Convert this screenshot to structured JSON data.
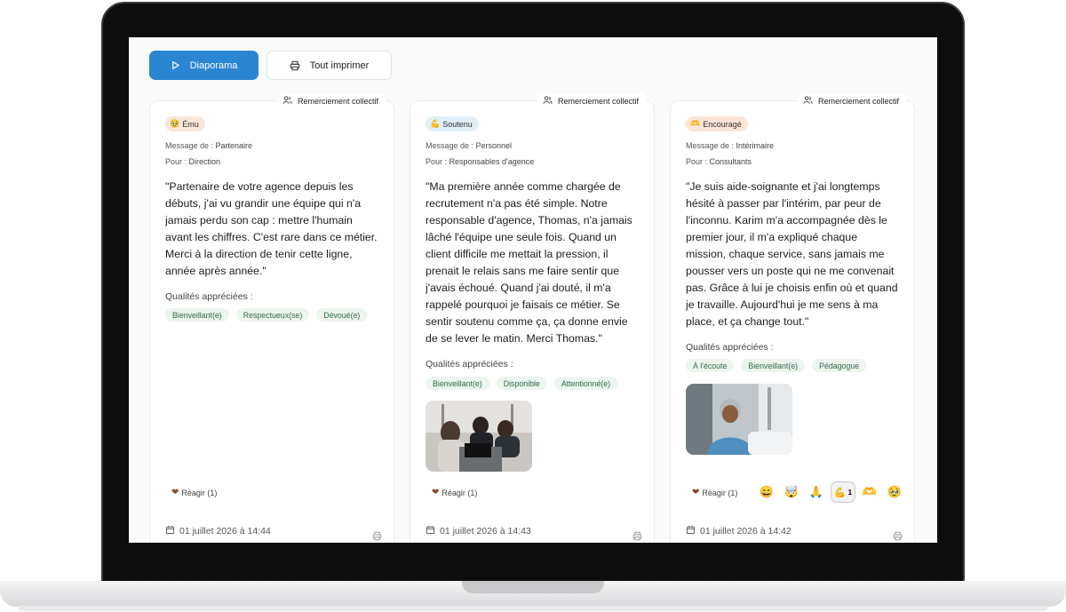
{
  "toolbar": {
    "slideshow_label": "Diaporama",
    "print_all_label": "Tout imprimer"
  },
  "cards": [
    {
      "tag": "Remerciement collectif",
      "mood_emoji": "🥹",
      "mood": "Ému",
      "from_label": "Message de : ",
      "from": "Partenaire",
      "to_label": "Pour : ",
      "to": "Direction",
      "quote": "\"Partenaire de votre agence depuis les débuts, j'ai vu grandir une équipe qui n'a jamais perdu son cap : mettre l'humain avant les chiffres. C'est rare dans ce métier. Merci à la direction de tenir cette ligne, année après année.\"",
      "qualities_label": "Qualités appréciées :",
      "qualities": [
        "Bienveillant(e)",
        "Respectueux(se)",
        "Dévoué(e)"
      ],
      "react_label": "Réagir (1)",
      "date": "01 juillet 2026 à 14:44"
    },
    {
      "tag": "Remerciement collectif",
      "mood_emoji": "💪",
      "mood": "Soutenu",
      "from_label": "Message de : ",
      "from": "Personnel",
      "to_label": "Pour : ",
      "to": "Responsables d'agence",
      "quote": "\"Ma première année comme chargée de recrutement n'a pas été simple. Notre responsable d'agence, Thomas, n'a jamais lâché l'équipe une seule fois. Quand un client difficile me mettait la pression, il prenait le relais sans me faire sentir que j'avais échoué. Quand j'ai douté, il m'a rappelé pourquoi je faisais ce métier. Se sentir soutenu comme ça, ça donne envie de se lever le matin. Merci Thomas.\"",
      "qualities_label": "Qualités appréciées :",
      "qualities": [
        "Bienveillant(e)",
        "Disponible",
        "Attentionné(e)"
      ],
      "react_label": "Réagir (1)",
      "date": "01 juillet 2026 à 14:43"
    },
    {
      "tag": "Remerciement collectif",
      "mood_emoji": "🫶",
      "mood": "Encouragé",
      "from_label": "Message de : ",
      "from": "Intérimaire",
      "to_label": "Pour : ",
      "to": "Consultants",
      "quote": "\"Je suis aide-soignante et j'ai longtemps hésité à passer par l'intérim, par peur de l'inconnu. Karim m'a accompagnée dès le premier jour, il m'a expliqué chaque mission, chaque service, sans jamais me pousser vers un poste qui ne me convenait pas. Grâce à lui je choisis enfin où et quand je travaille. Aujourd'hui je me sens à ma place, et ça change tout.\"",
      "qualities_label": "Qualités appréciées :",
      "qualities": [
        "À l'écoute",
        "Bienveillant(e)",
        "Pédagogue"
      ],
      "react_label": "Réagir (1)",
      "reactions": [
        "😄",
        "🤯",
        "🙏",
        "💪",
        "🫶",
        "🥹"
      ],
      "active_reaction_count": "1",
      "date": "01 juillet 2026 à 14:42"
    }
  ],
  "icons": {
    "heart": "heart-icon",
    "calendar": "calendar-icon",
    "printer": "printer-icon",
    "users": "users-icon",
    "play": "play-icon"
  },
  "colors": {
    "primary": "#2a86d3",
    "chip_bg": "#ecf5ee",
    "chip_text": "#2f6b47"
  }
}
